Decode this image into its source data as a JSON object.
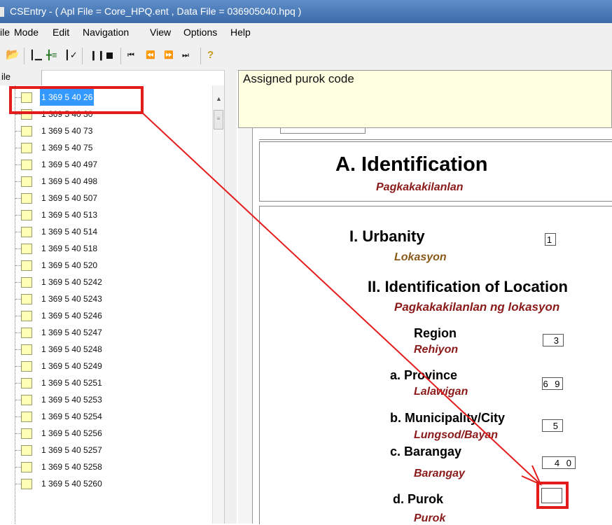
{
  "window": {
    "title": "CSEntry - ( Apl File = Core_HPQ.ent , Data File = 036905040.hpq )"
  },
  "menu": {
    "items": [
      "ile",
      "Mode",
      "Edit",
      "Navigation",
      "View",
      "Options",
      "Help"
    ]
  },
  "toolbar": {
    "icons": [
      "open-icon",
      "add-case-icon",
      "insert-case-icon",
      "verify-icon",
      "pause-icon",
      "stop-icon",
      "first-icon",
      "previous-icon",
      "next-icon",
      "last-icon",
      "help-icon"
    ]
  },
  "left_panel": {
    "header": "ile",
    "cases": [
      "1 369 5 40   26",
      "1 369 5 40   30",
      "1 369 5 40   73",
      "1 369 5 40   75",
      "1 369 5 40   497",
      "1 369 5 40   498",
      "1 369 5 40   507",
      "1 369 5 40   513",
      "1 369 5 40   514",
      "1 369 5 40   518",
      "1 369 5 40   520",
      "1 369 5 40  5242",
      "1 369 5 40  5243",
      "1 369 5 40  5246",
      "1 369 5 40  5247",
      "1 369 5 40  5248",
      "1 369 5 40  5249",
      "1 369 5 40  5251",
      "1 369 5 40  5253",
      "1 369 5 40  5254",
      "1 369 5 40  5256",
      "1 369 5 40  5257",
      "1 369 5 40  5258",
      "1 369 5 40  5260"
    ],
    "selected_index": 0
  },
  "message": {
    "text": "Assigned purok code"
  },
  "form": {
    "section_title": "A. Identification",
    "section_subtitle": "Pagkakakilanlan",
    "urbanity": {
      "label": "I.  Urbanity",
      "sublabel": "Lokasyon",
      "value": "1"
    },
    "location": {
      "label": "II.  Identification of Location",
      "sublabel": "Pagkakakilanlan ng lokasyon"
    },
    "region": {
      "label": "Region",
      "sublabel": "Rehiyon",
      "value": "3"
    },
    "province": {
      "label": "a.  Province",
      "sublabel": "Lalawigan",
      "value": "6 9"
    },
    "municipality": {
      "label": "b.  Municipality/City",
      "sublabel": "Lungsod/Bayan",
      "value": "5"
    },
    "barangay": {
      "label": "c.  Barangay",
      "sublabel": "Barangay",
      "value": "4 0"
    },
    "purok": {
      "label": "d.  Purok",
      "sublabel": "Purok",
      "value": ""
    }
  },
  "colors": {
    "highlight": "#e31b1b",
    "label_red": "#8b1a1a",
    "label_brown": "#8b5a1a",
    "message_bg": "#ffffe1"
  }
}
